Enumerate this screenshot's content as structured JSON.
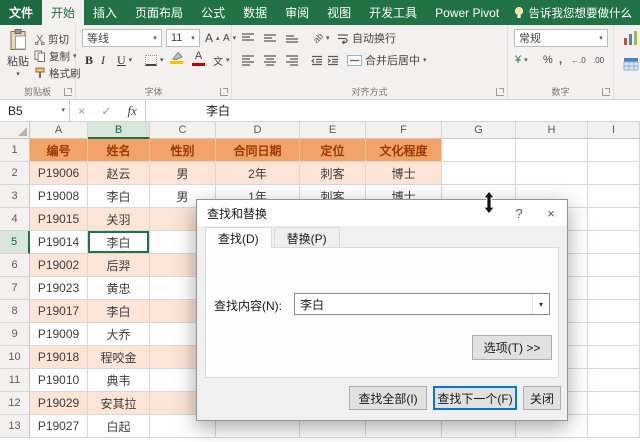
{
  "colors": {
    "ribbon_green": "#217346",
    "ribbon_file_green": "#1d6a40",
    "ribbon_bg": "#f3f1f0",
    "table_header_fill": "#f2a369",
    "table_header_text": "#9c3b00",
    "band_fill": "#fce4d6",
    "grid_line": "#d8d8d8",
    "selection": "#217346",
    "focus_blue": "#0078d7",
    "fill_icon_bar": "#ffc000",
    "font_color_bar": "#c00000"
  },
  "ribbon": {
    "tabs": [
      {
        "id": "file",
        "label": "文件",
        "file": true
      },
      {
        "id": "home",
        "label": "开始",
        "active": true
      },
      {
        "id": "insert",
        "label": "插入"
      },
      {
        "id": "page-layout",
        "label": "页面布局"
      },
      {
        "id": "formulas",
        "label": "公式"
      },
      {
        "id": "data",
        "label": "数据"
      },
      {
        "id": "review",
        "label": "审阅"
      },
      {
        "id": "view",
        "label": "视图"
      },
      {
        "id": "developer",
        "label": "开发工具"
      },
      {
        "id": "power-pivot",
        "label": "Power Pivot"
      }
    ],
    "tell_me": "告诉我您想要做什么",
    "clipboard": {
      "label": "剪贴板",
      "paste": "粘贴",
      "cut": "剪切",
      "copy": "复制",
      "format_painter": "格式刷"
    },
    "font": {
      "label": "字体",
      "font_name": "等线",
      "font_size": "11",
      "bold": "B",
      "italic": "I",
      "underline": "U"
    },
    "alignment": {
      "label": "对齐方式",
      "wrap_text": "自动换行",
      "merge_center": "合并后居中"
    },
    "number": {
      "label": "数字",
      "format": "常规",
      "currency": "¥",
      "percent": "%",
      "comma": ","
    }
  },
  "formula_bar": {
    "name_box": "B5",
    "fx": "fx",
    "content": "李白"
  },
  "sheet": {
    "selection": "B5",
    "col_headers": [
      "A",
      "B",
      "C",
      "D",
      "E",
      "F",
      "G",
      "H",
      "I"
    ],
    "table_header": [
      "编号",
      "姓名",
      "性别",
      "合同日期",
      "定位",
      "文化程度"
    ],
    "rows": [
      {
        "n": 2,
        "cells": [
          "P19006",
          "赵云",
          "男",
          "2年",
          "刺客",
          "博士"
        ]
      },
      {
        "n": 3,
        "cells": [
          "P19008",
          "李白",
          "男",
          "1年",
          "刺客",
          "博士"
        ]
      },
      {
        "n": 4,
        "cells": [
          "P19015",
          "关羽",
          "",
          "",
          "",
          ""
        ]
      },
      {
        "n": 5,
        "cells": [
          "P19014",
          "李白",
          "",
          "",
          "",
          ""
        ]
      },
      {
        "n": 6,
        "cells": [
          "P19002",
          "后羿",
          "",
          "",
          "",
          ""
        ]
      },
      {
        "n": 7,
        "cells": [
          "P19023",
          "黄忠",
          "",
          "",
          "",
          ""
        ]
      },
      {
        "n": 8,
        "cells": [
          "P19017",
          "李白",
          "",
          "",
          "",
          ""
        ]
      },
      {
        "n": 9,
        "cells": [
          "P19009",
          "大乔",
          "",
          "",
          "",
          ""
        ]
      },
      {
        "n": 10,
        "cells": [
          "P19018",
          "程咬金",
          "",
          "",
          "",
          ""
        ]
      },
      {
        "n": 11,
        "cells": [
          "P19010",
          "典韦",
          "",
          "",
          "",
          ""
        ]
      },
      {
        "n": 12,
        "cells": [
          "P19029",
          "安其拉",
          "",
          "",
          "",
          ""
        ]
      },
      {
        "n": 13,
        "cells": [
          "P19027",
          "白起",
          "",
          "",
          "",
          ""
        ]
      }
    ]
  },
  "dialog": {
    "title": "查找和替换",
    "help": "?",
    "close": "×",
    "tabs": [
      {
        "id": "find",
        "label": "查找(D)",
        "active": true
      },
      {
        "id": "replace",
        "label": "替换(P)"
      }
    ],
    "find_label": "查找内容(N):",
    "find_value": "李白",
    "options_button": "选项(T) >>",
    "find_all": "查找全部(I)",
    "find_next": "查找下一个(F)",
    "close_button": "关闭"
  }
}
